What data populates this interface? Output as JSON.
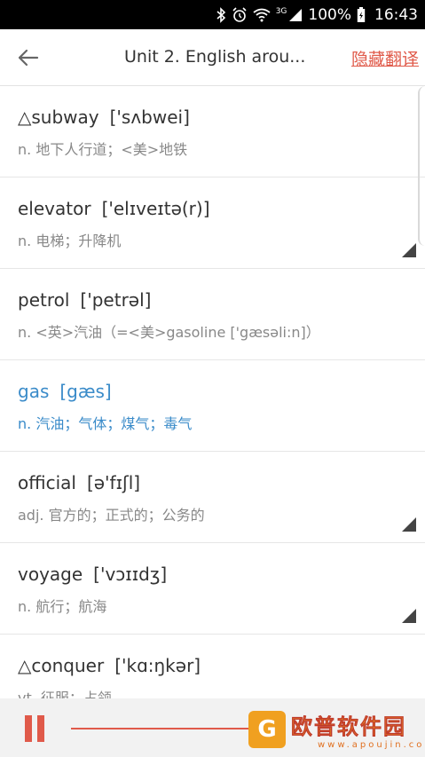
{
  "status_bar": {
    "network": "3G",
    "battery": "100%",
    "time": "16:43"
  },
  "header": {
    "title": "Unit 2. English arou...",
    "hide_translation": "隐藏翻译"
  },
  "words": [
    {
      "word": "△subway",
      "phonetic": "['sʌbwei]",
      "meaning": "n. 地下人行道；<美>地铁",
      "active": false,
      "corner": false
    },
    {
      "word": "elevator",
      "phonetic": "['elɪveɪtə(r)]",
      "meaning": "n. 电梯；升降机",
      "active": false,
      "corner": true
    },
    {
      "word": "petrol",
      "phonetic": "['petrəl]",
      "meaning": "n. <英>汽油（=<美>gasoline ['gæsəli:n]）",
      "active": false,
      "corner": false
    },
    {
      "word": "gas",
      "phonetic": "[gæs]",
      "meaning": "n. 汽油；气体；煤气；毒气",
      "active": true,
      "corner": false
    },
    {
      "word": "official",
      "phonetic": "[ə'fɪʃl]",
      "meaning": "adj. 官方的；正式的；公务的",
      "active": false,
      "corner": true
    },
    {
      "word": "voyage",
      "phonetic": "['vɔɪɪdʒ]",
      "meaning": "n. 航行；航海",
      "active": false,
      "corner": true
    },
    {
      "word": "△conquer",
      "phonetic": "['kɑ:ŋkər]",
      "meaning": "vt. 征服；占领",
      "active": false,
      "corner": false
    }
  ],
  "player": {
    "watermark_name": "欧普软件园",
    "watermark_url": "www.apoujin.com"
  },
  "colors": {
    "accent": "#e05a4a",
    "active_word": "#3a8bc9"
  }
}
